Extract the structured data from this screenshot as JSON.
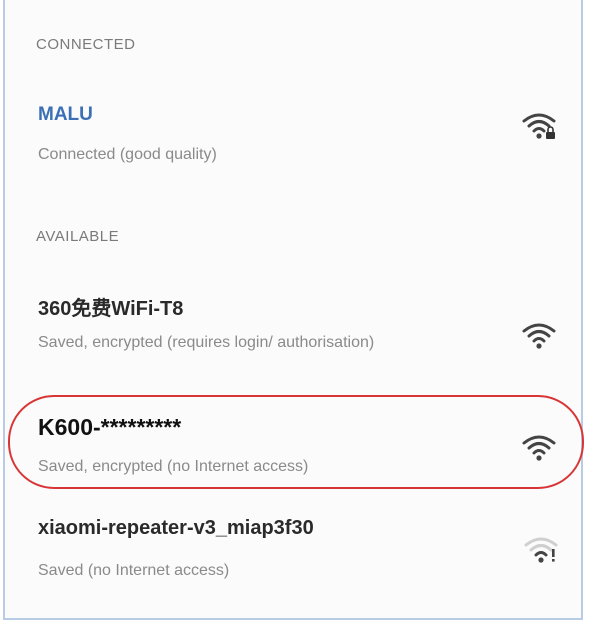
{
  "sections": {
    "connected_label": "CONNECTED",
    "available_label": "AVAILABLE"
  },
  "connected": {
    "name": "MALU",
    "status": "Connected (good quality)",
    "icon": "wifi-full-locked-icon"
  },
  "networks": [
    {
      "name": "360免费WiFi-T8",
      "status": "Saved, encrypted (requires login/ authorisation)",
      "icon": "wifi-full-icon"
    },
    {
      "name": "K600-*********",
      "status": "Saved, encrypted (no Internet access)",
      "icon": "wifi-full-icon"
    },
    {
      "name": "xiaomi-repeater-v3_miap3f30",
      "status": "Saved (no Internet access)",
      "icon": "wifi-weak-no-internet-icon"
    }
  ],
  "colors": {
    "accent": "#3b6fb6",
    "highlight": "#d83636",
    "frame": "#b9cce6"
  }
}
